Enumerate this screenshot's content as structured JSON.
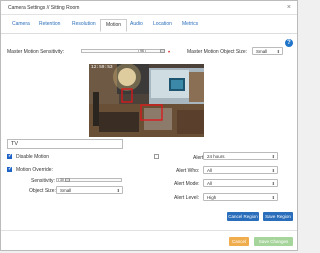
{
  "window": {
    "title": "Camera Settings // Sitting Room"
  },
  "tabs": [
    {
      "label": "Camera"
    },
    {
      "label": "Retention"
    },
    {
      "label": "Resolution"
    },
    {
      "label": "Motion"
    },
    {
      "label": "Audio"
    },
    {
      "label": "Location"
    },
    {
      "label": "Metrics"
    }
  ],
  "active_tab": "Motion",
  "motion": {
    "sensitivity_label": "Master Motion Sensitivity:",
    "sensitivity_value": "96",
    "object_size_label": "Master Motion Object Size:",
    "object_size_value": "Small"
  },
  "camera": {
    "timestamp": "12:59:53"
  },
  "region": {
    "name": "TV",
    "disable_motion_label": "Disable Motion",
    "disable_motion_checked": true,
    "motion_override_label": "Motion Override:",
    "motion_override_checked": true,
    "sensitivity_label": "Sensitivity:",
    "sensitivity_value": "30",
    "object_size_label": "Object Size:",
    "object_size_value": "Small"
  },
  "alert": {
    "label": "Alert:",
    "checked": false,
    "duration_value": "24 hours",
    "who_label": "Alert Who:",
    "who_value": "All",
    "mode_label": "Alert Mode:",
    "mode_value": "All",
    "level_label": "Alert Level:",
    "level_value": "High"
  },
  "buttons": {
    "cancel_region": "Cancel Region",
    "save_region": "Save Region",
    "cancel": "Cancel",
    "save_changes": "Save Changes"
  },
  "colors": {
    "accent": "#2a6ebb",
    "region_box": "#e0161b",
    "cancel": "#f0ad4e",
    "save_changes": "#a6d59c"
  }
}
